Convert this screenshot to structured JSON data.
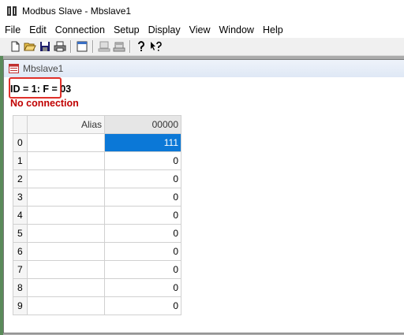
{
  "window": {
    "title": "Modbus Slave - Mbslave1"
  },
  "menu": [
    "File",
    "Edit",
    "Connection",
    "Setup",
    "Display",
    "View",
    "Window",
    "Help"
  ],
  "toolbar": [
    "new-icon",
    "open-icon",
    "save-icon",
    "print-icon",
    "window-icon",
    "connect-icon",
    "disconnect-icon",
    "help-icon",
    "context-help-icon"
  ],
  "child": {
    "title": "Mbslave1",
    "status_id": "ID = 1: F = 03",
    "status_connection": "No connection",
    "status_connection_color": "#c00000",
    "highlight_color": "#e0302a"
  },
  "grid": {
    "alias_header": "Alias",
    "register_header": "00000",
    "rows": [
      {
        "index": "0",
        "alias": "",
        "value": "111",
        "selected": true
      },
      {
        "index": "1",
        "alias": "",
        "value": "0"
      },
      {
        "index": "2",
        "alias": "",
        "value": "0"
      },
      {
        "index": "3",
        "alias": "",
        "value": "0"
      },
      {
        "index": "4",
        "alias": "",
        "value": "0"
      },
      {
        "index": "5",
        "alias": "",
        "value": "0"
      },
      {
        "index": "6",
        "alias": "",
        "value": "0"
      },
      {
        "index": "7",
        "alias": "",
        "value": "0"
      },
      {
        "index": "8",
        "alias": "",
        "value": "0"
      },
      {
        "index": "9",
        "alias": "",
        "value": "0"
      }
    ],
    "selected_color": "#0b78d7"
  }
}
